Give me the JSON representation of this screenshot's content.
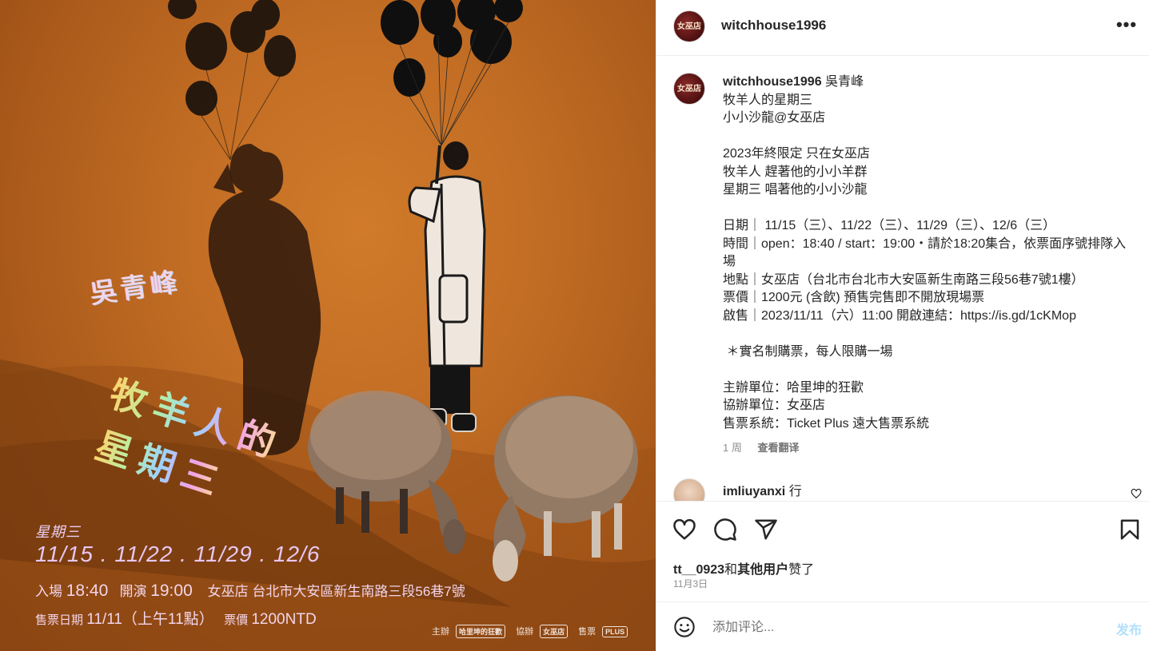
{
  "poster": {
    "singer": "吳青峰",
    "title_line1": "牧羊人的",
    "title_line2": "星期三",
    "weekday": "星期三",
    "dates": "11/15 . 11/22 . 11/29 . 12/6",
    "entry_label": "入場",
    "entry_time": "18:40",
    "show_label": "開演",
    "show_time": "19:00",
    "venue": "女巫店 台北市大安區新生南路三段56巷7號",
    "sale_label": "售票日期",
    "sale_date": "11/11（上午11點）",
    "price_label": "票價",
    "price": "1200NTD",
    "organizer_label": "主辦",
    "coorganizer_label": "協辦",
    "ticketing_label": "售票",
    "ticketing_logo": "PLUS",
    "organizer_logo": "哈里坤的狂歡",
    "coorganizer_logo": "女巫店"
  },
  "header": {
    "username": "witchhouse1996",
    "avatar_text": "女巫店",
    "more_label": "•••"
  },
  "caption": {
    "username": "witchhouse1996",
    "lines": [
      "吳青峰",
      "牧羊人的星期三",
      "小小沙龍@女巫店",
      "",
      "2023年終限定 只在女巫店",
      "牧羊人 趕著他的小小羊群",
      "星期三 唱著他的小小沙龍",
      "",
      "日期｜ 11/15（三）、11/22（三）、11/29（三）、12/6（三）",
      "時間｜open：18:40 / start：19:00・請於18:20集合，依票面序號排隊入場",
      "地點｜女巫店（台北市台北市大安區新生南路三段56巷7號1樓）",
      "票價｜1200元 (含飲) 預售完售即不開放現場票",
      "啟售｜2023/11/11（六）11:00 開啟連結：https://is.gd/1cKMop",
      "",
      " ＊實名制購票，每人限購一場",
      "",
      "主辦單位：哈里坤的狂歡",
      "協辦單位：女巫店",
      "售票系統：Ticket Plus 遠大售票系統"
    ],
    "time_ago": "1 周",
    "translate_label": "查看翻译"
  },
  "comment": {
    "username": "imliuyanxi",
    "text": "行"
  },
  "actions": {
    "liked_user": "tt__0923",
    "liked_joiner": "和",
    "liked_others": "其他用户",
    "liked_suffix": "赞了",
    "date": "11月3日"
  },
  "add_comment": {
    "placeholder": "添加评论...",
    "post_label": "发布"
  }
}
